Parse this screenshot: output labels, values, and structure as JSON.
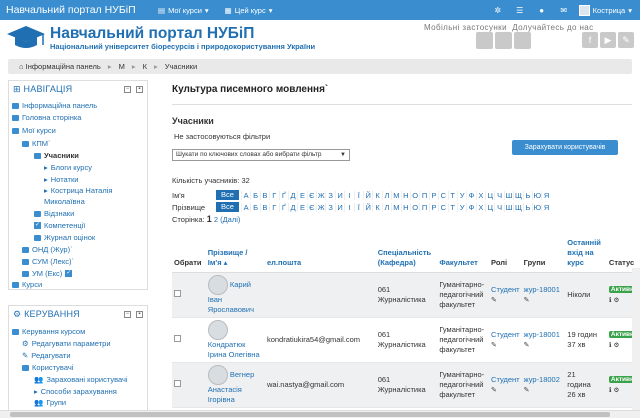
{
  "navbar": {
    "brand": "Навчальний портал НУБіП",
    "my_courses": "Мої курси",
    "this_course": "Цей курс",
    "user_name": "Кострица"
  },
  "header": {
    "title": "Навчальний портал НУБіП",
    "subtitle": "Національний університет біоресурсів і природокористування України",
    "mobile": "Мобільні застосунки",
    "social": "Долучайтесь до нас"
  },
  "breadcrumb": [
    "Інформаційна панель",
    "М",
    "К",
    "Учасники"
  ],
  "navigation": {
    "title": "НАВІГАЦІЯ",
    "items": [
      "Інформаційна панель",
      "Головна сторінка",
      "Мої курси",
      "КПМ`",
      "Учасники",
      "Блоги курсу",
      "Нотатки",
      "Кострица Наталія",
      "Миколаївна",
      "Відзнаки",
      "Компетенції",
      "Журнал оцінок",
      "ОНД (Жур)`",
      "СУМ (Лекс)`",
      "УМ (Екс)",
      "Курси"
    ]
  },
  "admin": {
    "title": "КЕРУВАННЯ",
    "items": [
      "Керування курсом",
      "Редагувати параметри",
      "Редагувати",
      "Користувачі",
      "Зараховані користувачі",
      "Способи зарахування",
      "Групи"
    ]
  },
  "main": {
    "course_title": "Культура писемного мовлення`",
    "participants_heading": "Учасники",
    "no_filters": "Не застосовуються фільтри",
    "search_placeholder": "Шукати по ключових словах або вибрати фільтр",
    "enrol_button": "Зарахувати користувачів",
    "count": "Кількість учасників: 32",
    "firstname_label": "Ім'я",
    "lastname_label": "Прізвище",
    "all_label": "Все",
    "letters": [
      "А",
      "Б",
      "В",
      "Г",
      "Ґ",
      "Д",
      "Е",
      "Є",
      "Ж",
      "З",
      "И",
      "І",
      "Ї",
      "Й",
      "К",
      "Л",
      "М",
      "Н",
      "О",
      "П",
      "Р",
      "С",
      "Т",
      "У",
      "Ф",
      "Х",
      "Ц",
      "Ч",
      "Ш",
      "Щ",
      "Ь",
      "Ю",
      "Я"
    ],
    "page_label": "Сторінка:",
    "page_current": "1",
    "page_next": "2",
    "page_next_label": "(Далі)"
  },
  "table": {
    "headers": {
      "select": "Обрати",
      "name": "Прізвище / Ім'я",
      "email": "ел.пошта",
      "speciality": "Спеціальність (Кафедра)",
      "faculty": "Факультет",
      "roles": "Ролі",
      "groups": "Групи",
      "last_access": "Останній вхід на курс",
      "status": "Статус"
    },
    "rows": [
      {
        "name1": "Карий",
        "name2": "Іван",
        "name3": "Ярославович",
        "email": "",
        "spec1": "061",
        "spec2": "Журналістика",
        "fac1": "Гуманітарно-",
        "fac2": "педагогічний",
        "fac3": "факультет",
        "role": "Студент",
        "group": "жур-18001",
        "access1": "Ніколи",
        "access2": "",
        "status": "Активно"
      },
      {
        "name1": "Кондратюк",
        "name2": "Ірина Олегівна",
        "name3": "",
        "email": "kondratiukira54@gmail.com",
        "spec1": "061",
        "spec2": "Журналістика",
        "fac1": "Гуманітарно-",
        "fac2": "педагогічний",
        "fac3": "факультет",
        "role": "Студент",
        "group": "жур-18001",
        "access1": "19 годин",
        "access2": "37 хв",
        "status": "Активно"
      },
      {
        "name1": "Вегнер",
        "name2": "Анастасія",
        "name3": "Ігорівна",
        "email": "wai.nastya@gmail.com",
        "spec1": "061",
        "spec2": "Журналістика",
        "fac1": "Гуманітарно-",
        "fac2": "педагогічний",
        "fac3": "факультет",
        "role": "Студент",
        "group": "жур-18002",
        "access1": "21",
        "access2": "година",
        "access3": "26 хв",
        "status": "Активно"
      }
    ]
  },
  "colors": {
    "brand": "#3a8ed0",
    "link": "#1f6fb2",
    "active_badge": "#3aa24a"
  }
}
